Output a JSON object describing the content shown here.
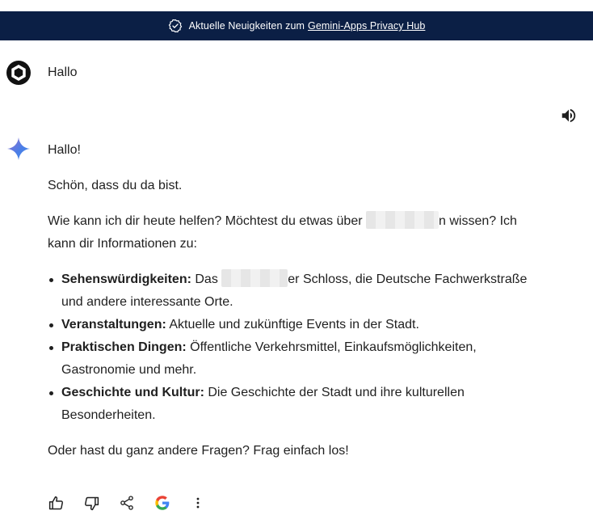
{
  "banner": {
    "text": "Aktuelle Neuigkeiten zum",
    "link": "Gemini-Apps Privacy Hub",
    "icon": "verified-check-icon"
  },
  "user_message": {
    "avatar_icon": "user-avatar-icon",
    "text": "Hallo"
  },
  "response": {
    "greeting": "Hallo!",
    "welcome": "Schön, dass du da bist.",
    "question_before": "Wie kann ich dir heute helfen? Möchtest du etwas über ",
    "question_after": "n wissen? Ich kann dir Informationen zu:",
    "topics": [
      {
        "title": "Sehenswürdigkeiten:",
        "text_before": " Das ",
        "text_after": "er Schloss, die Deutsche Fachwerkstraße und andere interessante Orte."
      },
      {
        "title": "Veranstaltungen:",
        "text": " Aktuelle und zukünftige Events in der Stadt."
      },
      {
        "title": "Praktischen Dingen:",
        "text": " Öffentliche Verkehrsmittel, Einkaufsmöglichkeiten, Gastronomie und mehr."
      },
      {
        "title": "Geschichte und Kultur:",
        "text": " Die Geschichte der Stadt und ihre kulturellen Besonderheiten."
      }
    ],
    "closing": "Oder hast du ganz andere Fragen? Frag einfach los!"
  },
  "actions": [
    "thumbs-up-icon",
    "thumbs-down-icon",
    "share-icon",
    "google-icon",
    "more-vert-icon"
  ],
  "colors": {
    "banner_bg": "#0b1f45",
    "text": "#1f1f1f",
    "gemini_blue": "#4a7ee8",
    "gemini_purple": "#9b72cb"
  }
}
